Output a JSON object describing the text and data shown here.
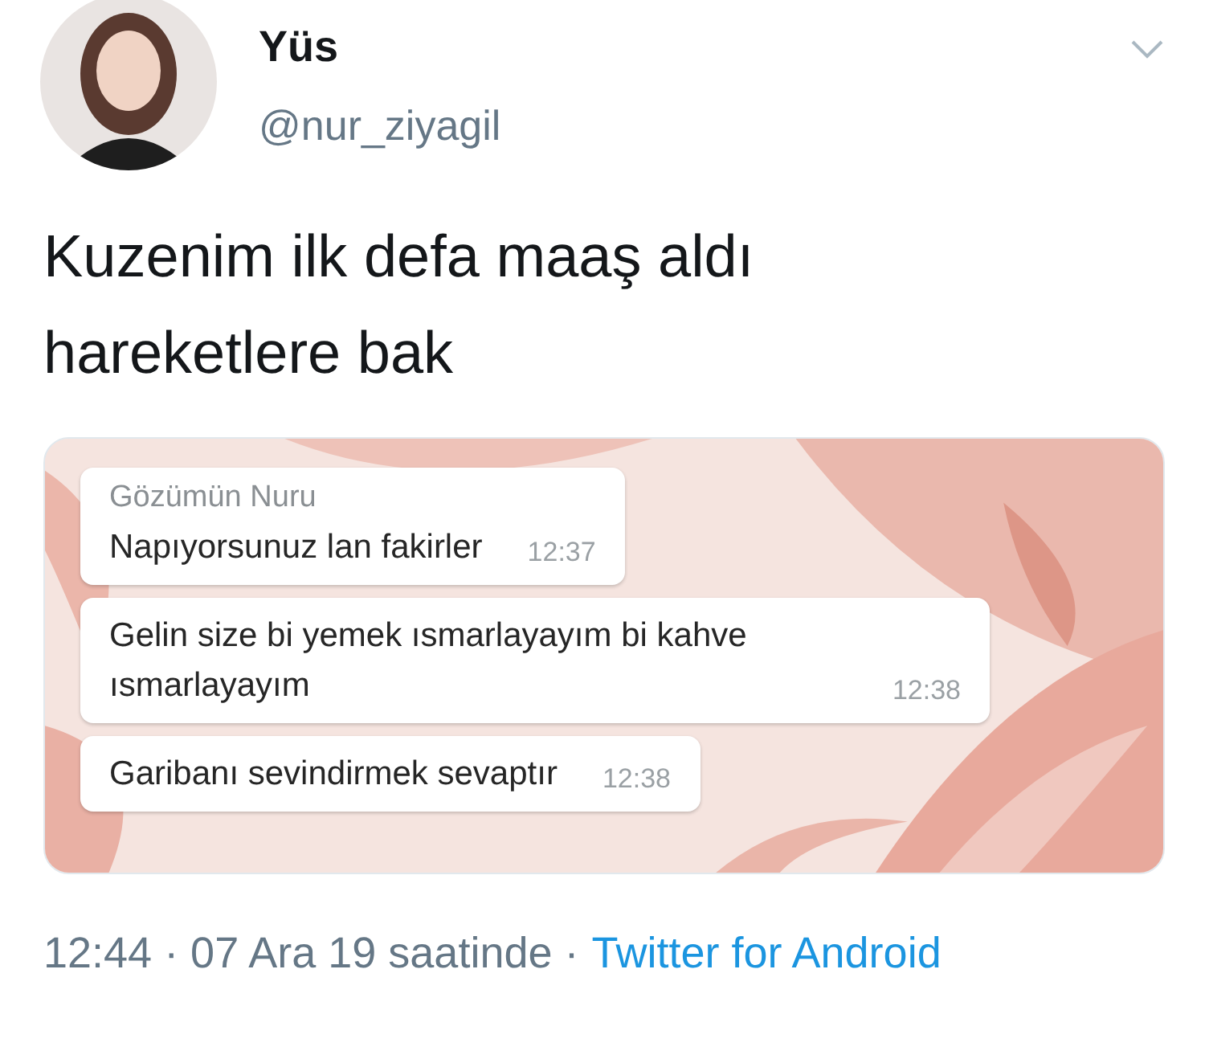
{
  "author": {
    "name": "Yüs",
    "handle": "@nur_ziyagil"
  },
  "tweet_text": "Kuzenim ilk defa maaş aldı hareketlere bak",
  "chat": {
    "sender": "Gözümün Nuru",
    "messages": [
      {
        "text": "Napıyorsunuz lan fakirler",
        "time": "12:37"
      },
      {
        "text": "Gelin size bi yemek ısmarlayayım bi kahve ısmarlayayım",
        "time": "12:38"
      },
      {
        "text": "Garibanı sevindirmek sevaptır",
        "time": "12:38"
      }
    ]
  },
  "meta": "12:44 · 07 Ara 19 saatinde ·",
  "source": "Twitter for Android"
}
